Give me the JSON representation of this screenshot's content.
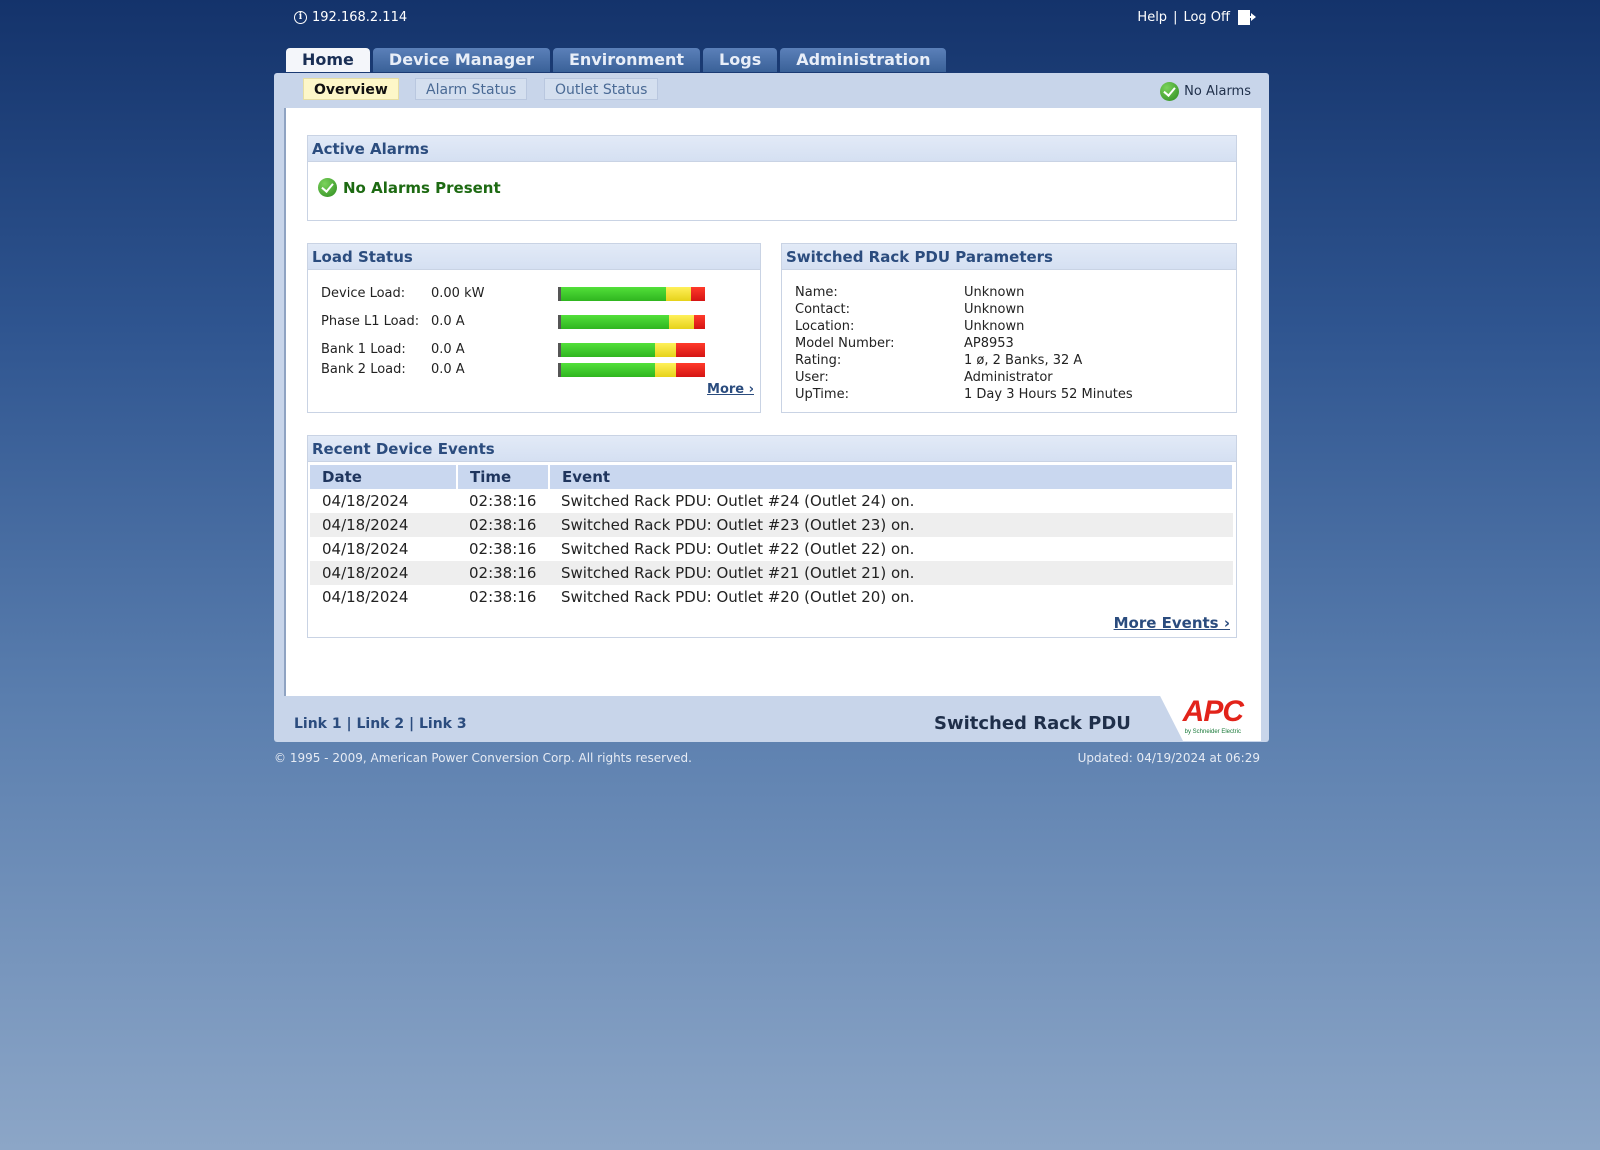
{
  "topbar": {
    "ip": "192.168.2.114",
    "help": "Help",
    "separator": "|",
    "logoff": "Log Off"
  },
  "tabs": [
    {
      "label": "Home"
    },
    {
      "label": "Device Manager"
    },
    {
      "label": "Environment"
    },
    {
      "label": "Logs"
    },
    {
      "label": "Administration"
    }
  ],
  "subtabs": [
    {
      "label": "Overview"
    },
    {
      "label": "Alarm Status"
    },
    {
      "label": "Outlet Status"
    }
  ],
  "status": {
    "label": "No Alarms"
  },
  "active_alarms": {
    "title": "Active Alarms",
    "message": "No Alarms Present"
  },
  "load_status": {
    "title": "Load Status",
    "more": "More ›",
    "rows": [
      {
        "label": "Device Load:",
        "value": "0.00 kW",
        "load_fraction": 0.0
      },
      {
        "label": "Phase L1 Load:",
        "value": "0.0 A",
        "load_fraction": 0.0
      },
      {
        "label": "Bank 1 Load:",
        "value": "0.0 A",
        "load_fraction": 0.0
      },
      {
        "label": "Bank 2 Load:",
        "value": "0.0 A",
        "load_fraction": 0.0
      }
    ]
  },
  "parameters": {
    "title": "Switched Rack PDU Parameters",
    "rows": [
      {
        "label": "Name:",
        "value": "Unknown"
      },
      {
        "label": "Contact:",
        "value": "Unknown"
      },
      {
        "label": "Location:",
        "value": "Unknown"
      },
      {
        "label": "Model Number:",
        "value": "AP8953"
      },
      {
        "label": "Rating:",
        "value": "1 ø, 2 Banks, 32 A"
      },
      {
        "label": "User:",
        "value": "Administrator"
      },
      {
        "label": "UpTime:",
        "value": "1 Day 3 Hours 52 Minutes"
      }
    ]
  },
  "events": {
    "title": "Recent Device Events",
    "columns": [
      "Date",
      "Time",
      "Event"
    ],
    "rows": [
      [
        "04/18/2024",
        "02:38:16",
        "Switched Rack PDU: Outlet #24 (Outlet 24) on."
      ],
      [
        "04/18/2024",
        "02:38:16",
        "Switched Rack PDU: Outlet #23 (Outlet 23) on."
      ],
      [
        "04/18/2024",
        "02:38:16",
        "Switched Rack PDU: Outlet #22 (Outlet 22) on."
      ],
      [
        "04/18/2024",
        "02:38:16",
        "Switched Rack PDU: Outlet #21 (Outlet 21) on."
      ],
      [
        "04/18/2024",
        "02:38:16",
        "Switched Rack PDU: Outlet #20 (Outlet 20) on."
      ]
    ],
    "more": "More Events ›"
  },
  "footer": {
    "links": [
      "Link 1",
      "Link 2",
      "Link 3"
    ],
    "product": "Switched Rack PDU",
    "logo_text": "APC",
    "logo_sub": "by Schneider Electric",
    "copyright": "© 1995 - 2009, American Power Conversion Corp. All rights reserved.",
    "updated": "Updated: 04/19/2024 at 06:29"
  },
  "colors": {
    "accent": "#2b4c7e",
    "ok_green": "#1d6a12",
    "brand_red": "#e2231a"
  }
}
